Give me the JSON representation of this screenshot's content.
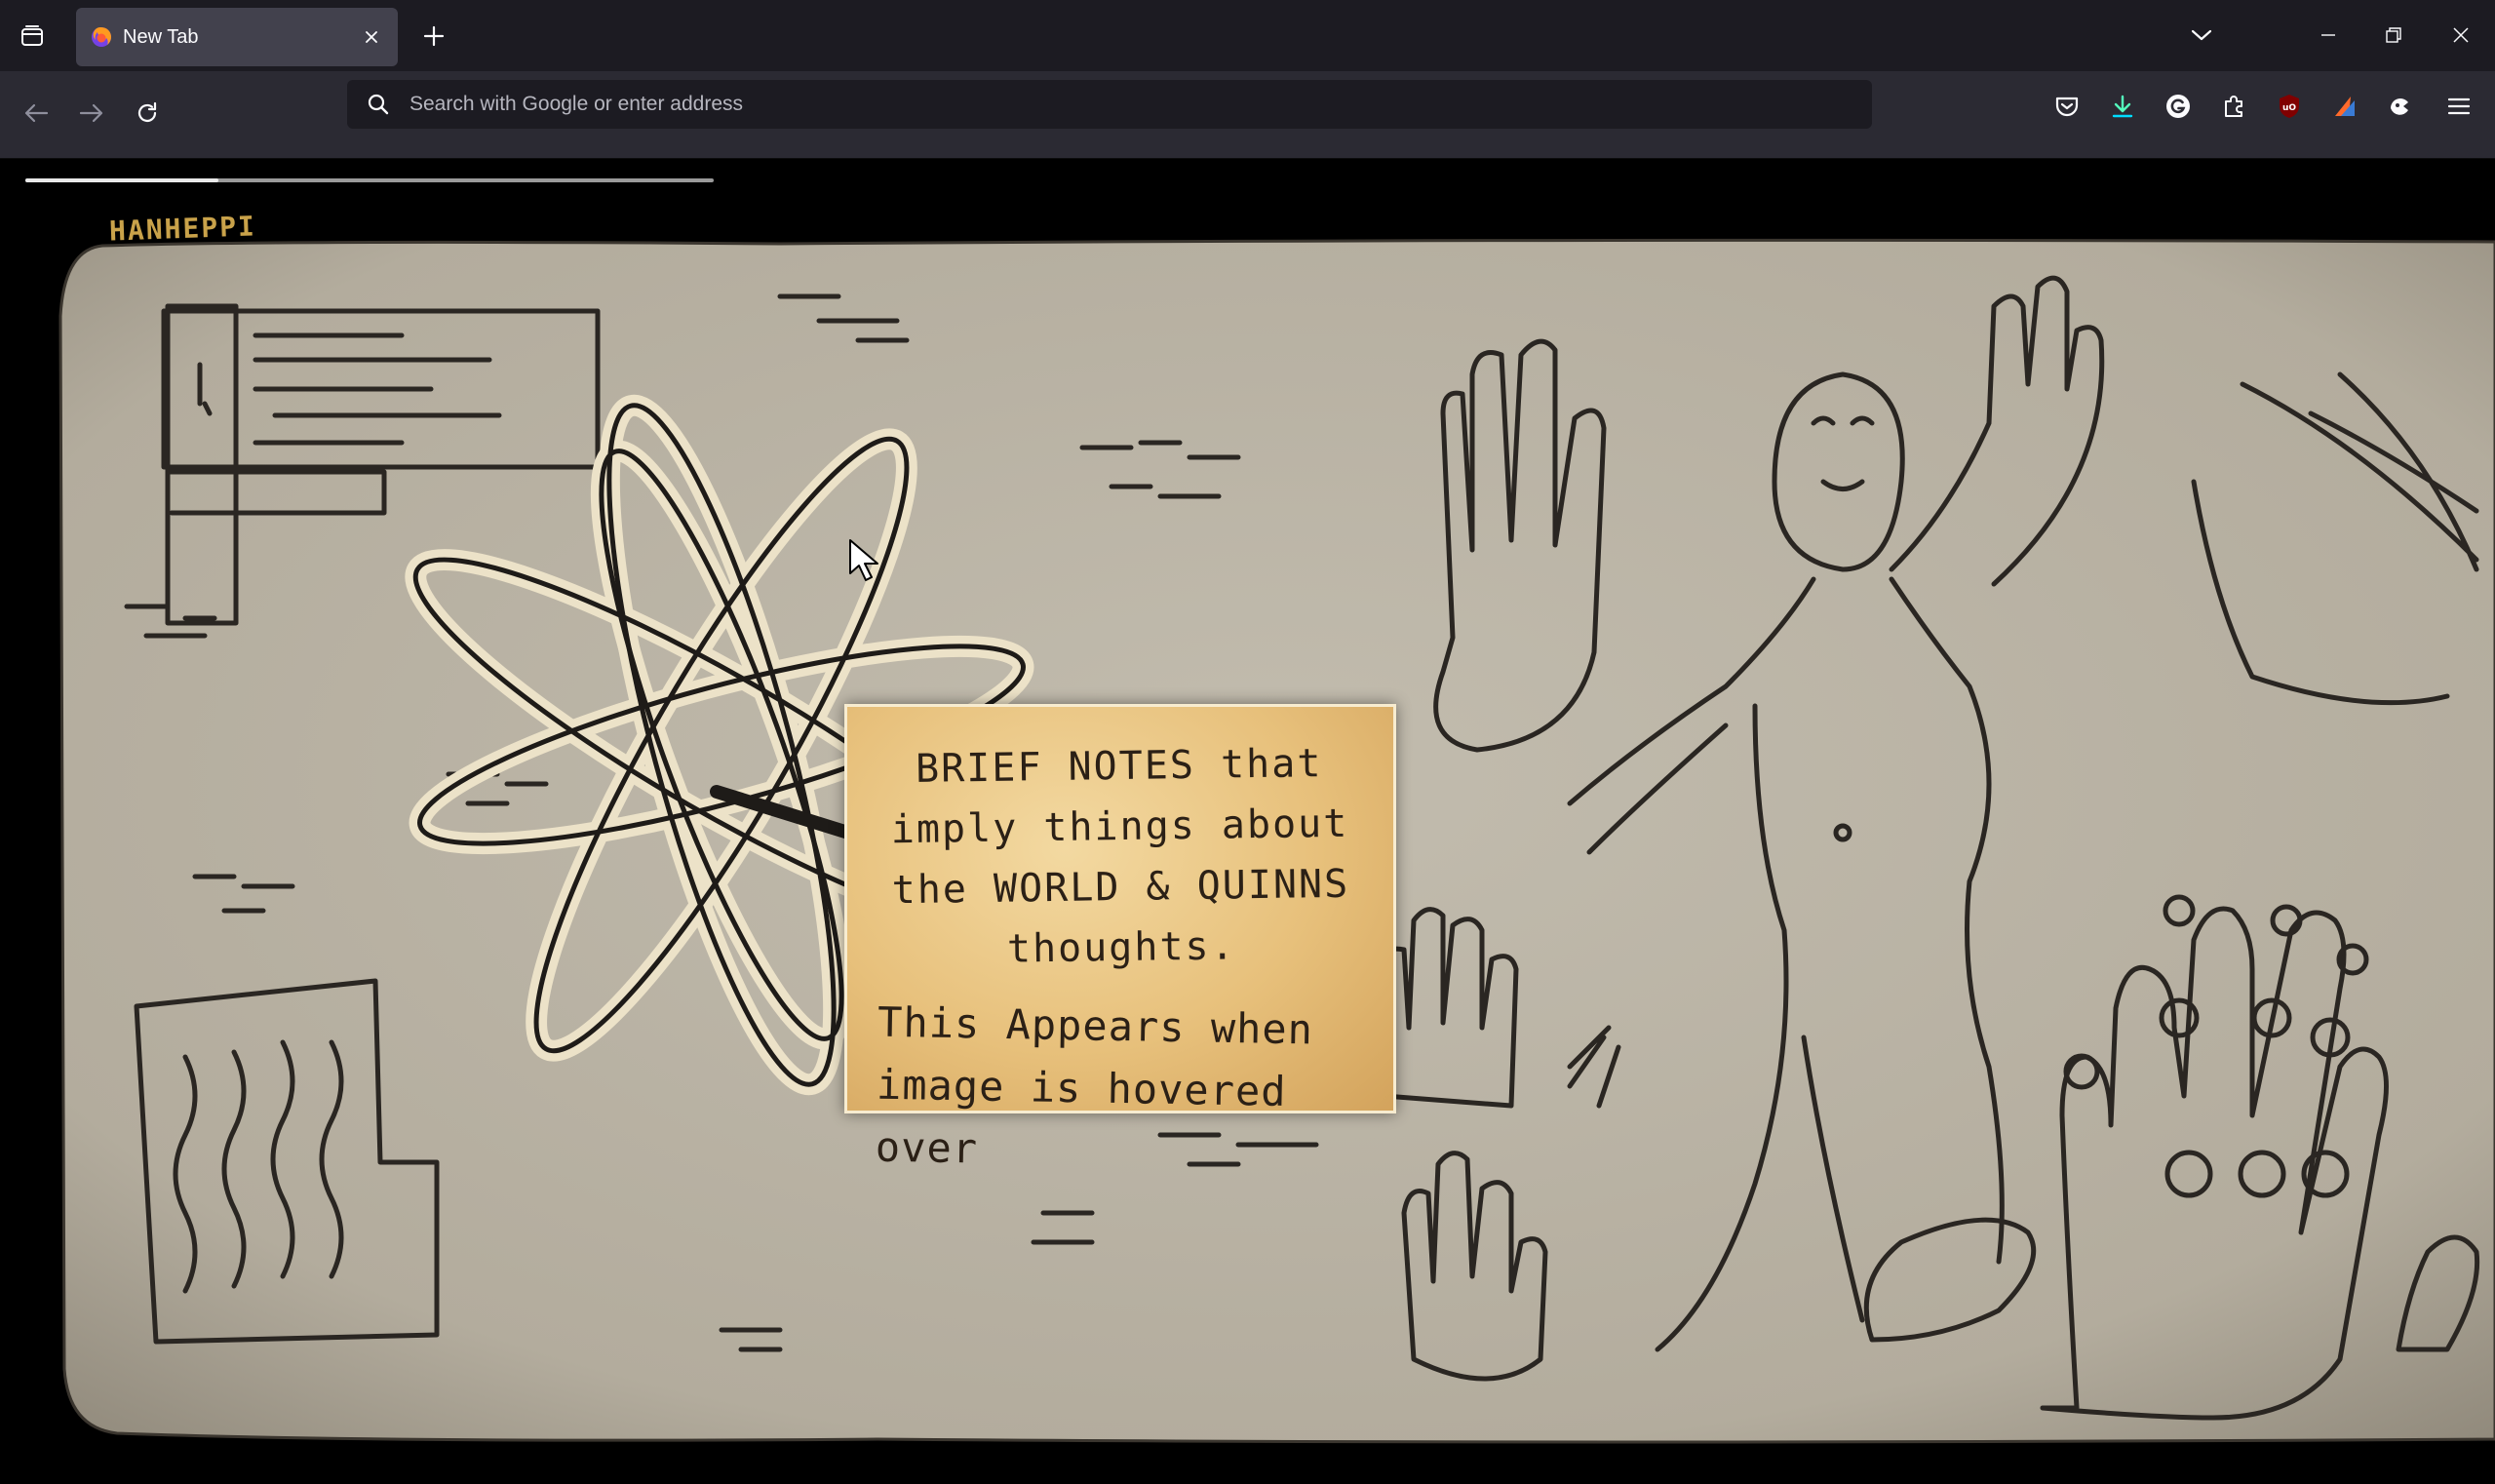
{
  "browser": {
    "tab": {
      "title": "New Tab"
    },
    "urlbar": {
      "placeholder": "Search with Google or enter address",
      "value": ""
    }
  },
  "page": {
    "logo_text": "HANHEPPI",
    "load_progress": 0.28,
    "note": {
      "line1": "BRIEF NOTES that imply things about the WORLD & QUINNS thoughts.",
      "line2": "This Appears when image is hovered over"
    }
  },
  "colors": {
    "tabstrip_bg": "#1c1b22",
    "navbar_bg": "#2b2a33",
    "urlbar_bg": "#1c1b22",
    "paper": "#b9b3a6",
    "ink": "#2a2622",
    "note_bg": "#e7c07b",
    "logo": "#c9a24a"
  },
  "icons": [
    "tab-list-icon",
    "firefox-icon",
    "close-icon",
    "plus-icon",
    "chevron-down-icon",
    "minimize-icon",
    "restore-icon",
    "back-icon",
    "forward-icon",
    "reload-icon",
    "search-icon",
    "pocket-icon",
    "download-icon",
    "grammarly-icon",
    "extensions-icon",
    "ublock-icon",
    "extension-icon",
    "extension-icon",
    "menu-icon"
  ]
}
